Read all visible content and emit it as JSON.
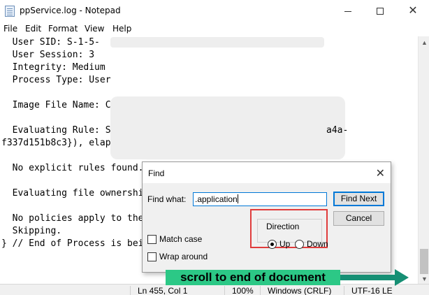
{
  "window": {
    "title": "ppService.log - Notepad",
    "menu": [
      "File",
      "Edit",
      "Format",
      "View",
      "Help"
    ],
    "close_glyph": "✕"
  },
  "editor": {
    "lines": [
      "  User SID: S-1-5-",
      "  User Session: 3",
      "  Integrity: Medium",
      "  Process Type: User",
      "",
      "  Image File Name: C",
      "",
      "  Evaluating Rule: S",
      "f337d151b8c3}), elap",
      "",
      "  No explicit rules found.",
      "",
      "  Evaluating file ownershi",
      "",
      "  No policies apply to the",
      "  Skipping.",
      "} // End of Process is bei"
    ],
    "fragment_right": "a4a-"
  },
  "statusbar": {
    "position": "Ln 455, Col 1",
    "zoom": "100%",
    "line_ending": "Windows (CRLF)",
    "encoding": "UTF-16 LE"
  },
  "find_dialog": {
    "title": "Find",
    "close_glyph": "✕",
    "find_what_label": "Find what:",
    "find_what_value": ".application",
    "find_next_label": "Find Next",
    "cancel_label": "Cancel",
    "direction_label": "Direction",
    "up_label": "Up",
    "down_label": "Down",
    "direction_selected": "Up",
    "match_case_label": "Match case",
    "match_case_checked": false,
    "wrap_around_label": "Wrap around",
    "wrap_around_checked": false
  },
  "annotation": {
    "text": "scroll to end of document",
    "background": "#2cc886",
    "arrow_color": "#168f74",
    "highlight_color": "#e03c3c"
  }
}
